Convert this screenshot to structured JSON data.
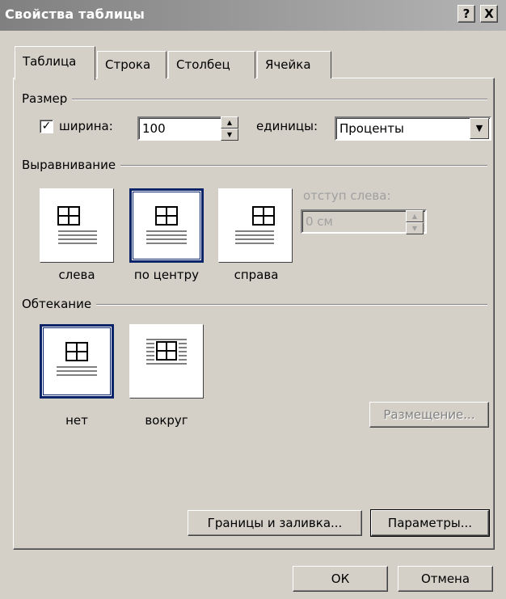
{
  "window": {
    "title": "Свойства таблицы",
    "help_label": "?",
    "close_label": "X"
  },
  "tabs": [
    {
      "label": "Таблица"
    },
    {
      "label": "Строка"
    },
    {
      "label": "Столбец"
    },
    {
      "label": "Ячейка"
    }
  ],
  "size": {
    "group_label": "Размер",
    "width_label": "ширина:",
    "width_value": "100",
    "units_label": "единицы:",
    "units_value": "Проценты",
    "width_checked": true
  },
  "alignment": {
    "group_label": "Выравнивание",
    "options": [
      {
        "label": "слева"
      },
      {
        "label": "по центру"
      },
      {
        "label": "справа"
      }
    ],
    "selected": "по центру",
    "indent_label": "отступ слева:",
    "indent_value": "0 см"
  },
  "wrapping": {
    "group_label": "Обтекание",
    "options": [
      {
        "label": "нет"
      },
      {
        "label": "вокруг"
      }
    ],
    "selected": "нет"
  },
  "buttons": {
    "placement": "Размещение...",
    "borders": "Границы и заливка...",
    "options": "Параметры...",
    "ok": "ОК",
    "cancel": "Отмена"
  }
}
